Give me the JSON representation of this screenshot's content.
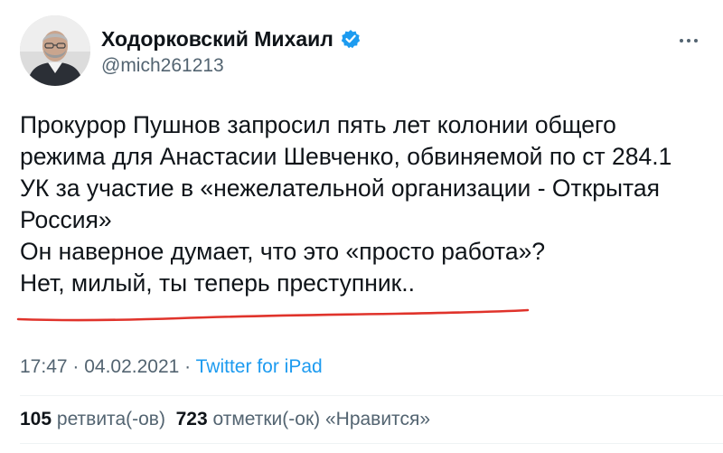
{
  "author": {
    "display_name": "Ходорковский Михаил",
    "handle": "@mich261213",
    "verified": true
  },
  "tweet": {
    "lines": [
      "Прокурор Пушнов запросил пять лет колонии общего",
      "режима для Анастасии Шевченко, обвиняемой по ст 284.1",
      "УК за участие в «нежелательной организации - Открытая",
      "Россия»",
      "Он наверное думает, что это «просто работа»?",
      "Нет, милый, ты теперь преступник.."
    ]
  },
  "meta": {
    "time": "17:47",
    "separator1": " · ",
    "date": "04.02.2021",
    "separator2": " · ",
    "source": "Twitter for iPad"
  },
  "stats": {
    "retweets_count": "105",
    "retweets_label": "ретвита(-ов)",
    "likes_count": "723",
    "likes_label": "отметки(-ок) «Нравится»"
  },
  "colors": {
    "text_primary": "#0f1419",
    "text_secondary": "#536471",
    "accent_blue": "#1d9bf0",
    "annotation_red": "#e0332b"
  },
  "icons": {
    "verified": "verified-badge-icon",
    "more": "more-options-icon"
  }
}
